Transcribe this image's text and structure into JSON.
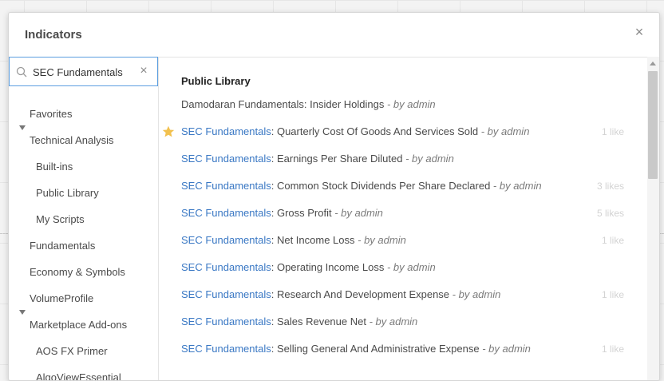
{
  "dialog": {
    "title": "Indicators",
    "close_label": "×"
  },
  "search": {
    "value": "SEC Fundamentals",
    "clear_label": "×"
  },
  "sidebar": {
    "items": [
      {
        "label": "Favorites"
      },
      {
        "label": "Technical Analysis"
      },
      {
        "label": "Built-ins"
      },
      {
        "label": "Public Library"
      },
      {
        "label": "My Scripts"
      },
      {
        "label": "Fundamentals"
      },
      {
        "label": "Economy & Symbols"
      },
      {
        "label": "VolumeProfile"
      },
      {
        "label": "Marketplace Add-ons"
      },
      {
        "label": "AOS FX Primer"
      },
      {
        "label": "AlgoViewEssential"
      }
    ]
  },
  "main": {
    "section_title": "Public Library",
    "results": [
      {
        "highlight": "",
        "name": "Damodaran Fundamentals: Insider Holdings",
        "author": " - by admin",
        "likes": ""
      },
      {
        "highlight": "SEC Fundamentals",
        "name": ": Quarterly Cost Of Goods And Services Sold",
        "author": " - by admin",
        "likes": "1 like",
        "favorite": true
      },
      {
        "highlight": "SEC Fundamentals",
        "name": ": Earnings Per Share Diluted",
        "author": " - by admin",
        "likes": ""
      },
      {
        "highlight": "SEC Fundamentals",
        "name": ": Common Stock Dividends Per Share Declared",
        "author": " - by admin",
        "likes": "3 likes"
      },
      {
        "highlight": "SEC Fundamentals",
        "name": ": Gross Profit",
        "author": " - by admin",
        "likes": "5 likes"
      },
      {
        "highlight": "SEC Fundamentals",
        "name": ": Net Income Loss",
        "author": " - by admin",
        "likes": "1 like"
      },
      {
        "highlight": "SEC Fundamentals",
        "name": ": Operating Income Loss",
        "author": " - by admin",
        "likes": ""
      },
      {
        "highlight": "SEC Fundamentals",
        "name": ": Research And Development Expense",
        "author": " - by admin",
        "likes": "1 like"
      },
      {
        "highlight": "SEC Fundamentals",
        "name": ": Sales Revenue Net",
        "author": " - by admin",
        "likes": ""
      },
      {
        "highlight": "SEC Fundamentals",
        "name": ": Selling General And Administrative Expense",
        "author": " - by admin",
        "likes": "1 like"
      }
    ]
  },
  "colors": {
    "accent": "#3a78c4",
    "star": "#f2c14e",
    "search_border": "#5c9ee0"
  },
  "icons": {
    "search": "search-icon",
    "clear": "close-icon",
    "close": "close-icon",
    "favorite": "star-icon",
    "expand": "triangle-down-icon"
  }
}
